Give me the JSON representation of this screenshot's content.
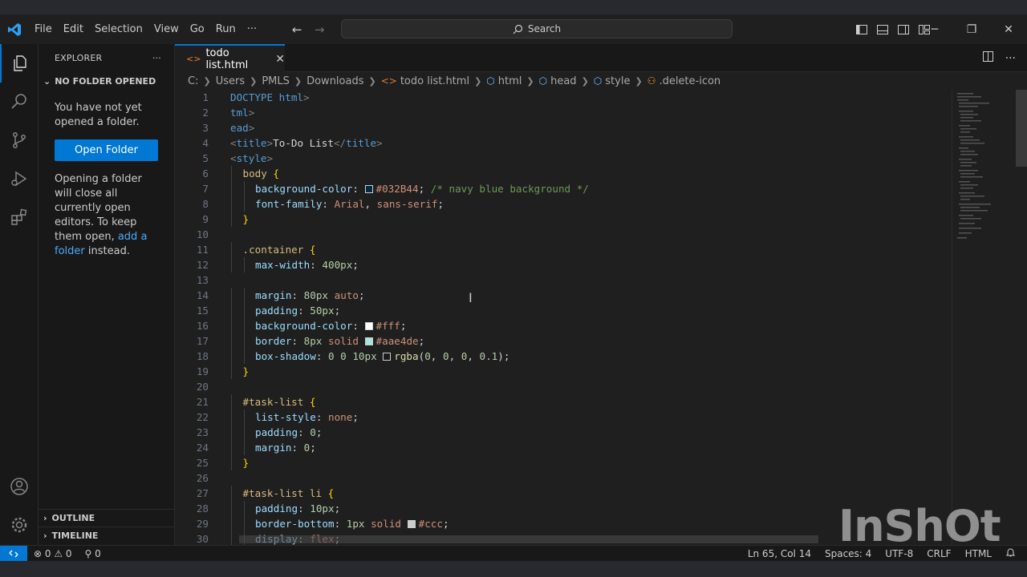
{
  "titlebar": {
    "menu": [
      "File",
      "Edit",
      "Selection",
      "View",
      "Go",
      "Run",
      "···"
    ],
    "search_placeholder": "Search",
    "accent": "#0078d4"
  },
  "sidebar": {
    "title": "EXPLORER",
    "more": "···",
    "section": "NO FOLDER OPENED",
    "message": "You have not yet opened a folder.",
    "open_button": "Open Folder",
    "hint_prefix": "Opening a folder will close all currently open editors. To keep them open, ",
    "hint_link": "add a folder",
    "hint_suffix": " instead.",
    "outline": "OUTLINE",
    "timeline": "TIMELINE"
  },
  "editor": {
    "tab_label": "todo list.html",
    "breadcrumb": [
      "C:",
      "Users",
      "PMLS",
      "Downloads",
      "todo list.html",
      "html",
      "head",
      "style",
      ".delete-icon"
    ],
    "lines": [
      {
        "n": "1",
        "indent": 0,
        "tokens": [
          [
            "t-tag",
            "DOCTYPE "
          ],
          [
            "t-tag",
            "html"
          ],
          [
            "t-punc",
            ">"
          ]
        ]
      },
      {
        "n": "2",
        "indent": 0,
        "tokens": [
          [
            "t-tag",
            "tml"
          ],
          [
            "t-punc",
            ">"
          ]
        ]
      },
      {
        "n": "3",
        "indent": 0,
        "tokens": [
          [
            "t-tag",
            "ead"
          ],
          [
            "t-punc",
            ">"
          ]
        ]
      },
      {
        "n": "4",
        "indent": 0,
        "tokens": [
          [
            "t-punc",
            "<"
          ],
          [
            "t-tag",
            "title"
          ],
          [
            "t-punc",
            ">"
          ],
          [
            "t-txt",
            "To-Do List"
          ],
          [
            "t-punc",
            "</"
          ],
          [
            "t-tag",
            "title"
          ],
          [
            "t-punc",
            ">"
          ]
        ]
      },
      {
        "n": "5",
        "indent": 0,
        "tokens": [
          [
            "t-punc",
            "<"
          ],
          [
            "t-tag",
            "style"
          ],
          [
            "t-punc",
            ">"
          ]
        ]
      },
      {
        "n": "6",
        "indent": 1,
        "tokens": [
          [
            "t-sel",
            "body "
          ],
          [
            "t-brace",
            "{"
          ]
        ]
      },
      {
        "n": "7",
        "indent": 2,
        "tokens": [
          [
            "t-prop",
            "background-color"
          ],
          [
            "t-txt",
            ": "
          ],
          [
            "swatch",
            "#032B44"
          ],
          [
            "t-val",
            "#032B44"
          ],
          [
            "t-txt",
            "; "
          ],
          [
            "t-com",
            "/* navy blue background */"
          ]
        ]
      },
      {
        "n": "8",
        "indent": 2,
        "tokens": [
          [
            "t-prop",
            "font-family"
          ],
          [
            "t-txt",
            ": "
          ],
          [
            "t-val",
            "Arial"
          ],
          [
            "t-txt",
            ", "
          ],
          [
            "t-val",
            "sans-serif"
          ],
          [
            "t-txt",
            ";"
          ]
        ]
      },
      {
        "n": "9",
        "indent": 1,
        "tokens": [
          [
            "t-brace",
            "}"
          ]
        ]
      },
      {
        "n": "10",
        "indent": 0,
        "tokens": []
      },
      {
        "n": "11",
        "indent": 1,
        "tokens": [
          [
            "t-sel",
            ".container "
          ],
          [
            "t-brace",
            "{"
          ]
        ]
      },
      {
        "n": "12",
        "indent": 2,
        "tokens": [
          [
            "t-prop",
            "max-width"
          ],
          [
            "t-txt",
            ": "
          ],
          [
            "t-num",
            "400px"
          ],
          [
            "t-txt",
            ";"
          ]
        ]
      },
      {
        "n": "13",
        "indent": 0,
        "tokens": []
      },
      {
        "n": "14",
        "indent": 2,
        "tokens": [
          [
            "t-prop",
            "margin"
          ],
          [
            "t-txt",
            ": "
          ],
          [
            "t-num",
            "80px"
          ],
          [
            "t-txt",
            " "
          ],
          [
            "t-val",
            "auto"
          ],
          [
            "t-txt",
            ";"
          ]
        ]
      },
      {
        "n": "15",
        "indent": 2,
        "tokens": [
          [
            "t-prop",
            "padding"
          ],
          [
            "t-txt",
            ": "
          ],
          [
            "t-num",
            "50px"
          ],
          [
            "t-txt",
            ";"
          ]
        ]
      },
      {
        "n": "16",
        "indent": 2,
        "tokens": [
          [
            "t-prop",
            "background-color"
          ],
          [
            "t-txt",
            ": "
          ],
          [
            "swatch",
            "#ffffff"
          ],
          [
            "t-val",
            "#fff"
          ],
          [
            "t-txt",
            ";"
          ]
        ]
      },
      {
        "n": "17",
        "indent": 2,
        "tokens": [
          [
            "t-prop",
            "border"
          ],
          [
            "t-txt",
            ": "
          ],
          [
            "t-num",
            "8px"
          ],
          [
            "t-txt",
            " "
          ],
          [
            "t-val",
            "solid"
          ],
          [
            "t-txt",
            " "
          ],
          [
            "swatch",
            "#aae4de"
          ],
          [
            "t-val",
            "#aae4de"
          ],
          [
            "t-txt",
            ";"
          ]
        ]
      },
      {
        "n": "18",
        "indent": 2,
        "tokens": [
          [
            "t-prop",
            "box-shadow"
          ],
          [
            "t-txt",
            ": "
          ],
          [
            "t-num",
            "0 0 10px"
          ],
          [
            "t-txt",
            " "
          ],
          [
            "swatch",
            "rgba(0,0,0,0.1)"
          ],
          [
            "t-fn",
            "rgba"
          ],
          [
            "t-txt",
            "("
          ],
          [
            "t-num",
            "0"
          ],
          [
            "t-txt",
            ", "
          ],
          [
            "t-num",
            "0"
          ],
          [
            "t-txt",
            ", "
          ],
          [
            "t-num",
            "0"
          ],
          [
            "t-txt",
            ", "
          ],
          [
            "t-num",
            "0.1"
          ],
          [
            "t-txt",
            ");"
          ]
        ]
      },
      {
        "n": "19",
        "indent": 1,
        "tokens": [
          [
            "t-brace",
            "}"
          ]
        ]
      },
      {
        "n": "20",
        "indent": 0,
        "tokens": []
      },
      {
        "n": "21",
        "indent": 1,
        "tokens": [
          [
            "t-sel",
            "#task-list "
          ],
          [
            "t-brace",
            "{"
          ]
        ]
      },
      {
        "n": "22",
        "indent": 2,
        "tokens": [
          [
            "t-prop",
            "list-style"
          ],
          [
            "t-txt",
            ": "
          ],
          [
            "t-val",
            "none"
          ],
          [
            "t-txt",
            ";"
          ]
        ]
      },
      {
        "n": "23",
        "indent": 2,
        "tokens": [
          [
            "t-prop",
            "padding"
          ],
          [
            "t-txt",
            ": "
          ],
          [
            "t-num",
            "0"
          ],
          [
            "t-txt",
            ";"
          ]
        ]
      },
      {
        "n": "24",
        "indent": 2,
        "tokens": [
          [
            "t-prop",
            "margin"
          ],
          [
            "t-txt",
            ": "
          ],
          [
            "t-num",
            "0"
          ],
          [
            "t-txt",
            ";"
          ]
        ]
      },
      {
        "n": "25",
        "indent": 1,
        "tokens": [
          [
            "t-brace",
            "}"
          ]
        ]
      },
      {
        "n": "26",
        "indent": 0,
        "tokens": []
      },
      {
        "n": "27",
        "indent": 1,
        "tokens": [
          [
            "t-sel",
            "#task-list li "
          ],
          [
            "t-brace",
            "{"
          ]
        ]
      },
      {
        "n": "28",
        "indent": 2,
        "tokens": [
          [
            "t-prop",
            "padding"
          ],
          [
            "t-txt",
            ": "
          ],
          [
            "t-num",
            "10px"
          ],
          [
            "t-txt",
            ";"
          ]
        ]
      },
      {
        "n": "29",
        "indent": 2,
        "tokens": [
          [
            "t-prop",
            "border-bottom"
          ],
          [
            "t-txt",
            ": "
          ],
          [
            "t-num",
            "1px"
          ],
          [
            "t-txt",
            " "
          ],
          [
            "t-val",
            "solid"
          ],
          [
            "t-txt",
            " "
          ],
          [
            "swatch",
            "#cccccc"
          ],
          [
            "t-val",
            "#ccc"
          ],
          [
            "t-txt",
            ";"
          ]
        ]
      },
      {
        "n": "30",
        "indent": 2,
        "tokens": [
          [
            "t-prop",
            "display"
          ],
          [
            "t-txt",
            ": "
          ],
          [
            "t-val",
            "flex"
          ],
          [
            "t-txt",
            ";"
          ]
        ]
      }
    ]
  },
  "statusbar": {
    "problems": "⊗ 0 ⚠ 0",
    "ports": "⚲ 0",
    "position": "Ln 65, Col 14",
    "spaces": "Spaces: 4",
    "encoding": "UTF-8",
    "eol": "CRLF",
    "language": "HTML"
  },
  "watermark": "InShOt"
}
